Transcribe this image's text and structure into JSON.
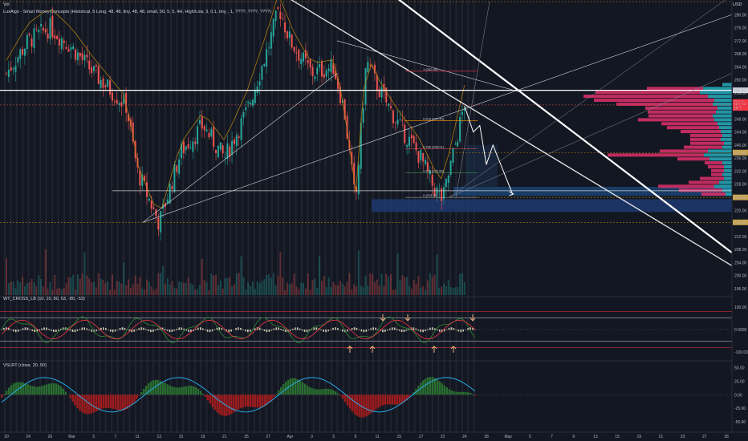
{
  "header": {
    "vol_label": "Vol",
    "smc_label": "LuxAlgo - Smart Money Concepts (Historical, 5 Long, 48, 48, tiny, 48, 48, small, 50, 5, 5, 4H, High/Low, 3, 0.1, tiny, , 1, ????, ????, ????)",
    "usd_label": "USD"
  },
  "panes": {
    "wt_label": "WT_CROSS_LB (10, 10, 80, 53, -80, -53)",
    "vslrt_label": "VSLRT (close, 20, 50)"
  },
  "price_axis": {
    "ticks": [
      "280.00",
      "276.00",
      "272.00",
      "268.00",
      "264.00",
      "260.00",
      "256.00",
      "252.00",
      "248.00",
      "244.00",
      "240.00",
      "236.00",
      "232.00",
      "228.00",
      "224.00",
      "220.00",
      "216.00",
      "212.00",
      "208.00",
      "204.00",
      "200.00",
      "196.00"
    ],
    "tick_values": [
      280,
      276,
      272,
      268,
      264,
      260,
      256,
      252,
      248,
      244,
      240,
      236,
      232,
      228,
      224,
      220,
      216,
      212,
      208,
      204,
      200,
      196
    ],
    "badges": [
      {
        "text": "256.80",
        "value": 256.8,
        "color": "#d1d4dc",
        "fg": "#131722"
      },
      {
        "text": "TSLA",
        "value": 253.2,
        "color": "#f23645",
        "fg": "#ffffff"
      },
      {
        "text": "252.75",
        "value": 252.3,
        "color": "#f23645",
        "fg": "#ffffff"
      },
      {
        "text": "1h 7",
        "value": 251.4,
        "color": "#f23645",
        "fg": "#ffffff"
      },
      {
        "text": "237.68",
        "value": 237.7,
        "color": "#c8a24a",
        "fg": "#131722"
      },
      {
        "text": "223.96",
        "value": 223.96,
        "color": "#c8a24a",
        "fg": "#131722"
      },
      {
        "text": "216.30",
        "value": 216.3,
        "color": "#c8a24a",
        "fg": "#131722"
      }
    ]
  },
  "wt_axis": {
    "ticks": [
      "100.00",
      "0.0000",
      "-100.00"
    ],
    "tick_values": [
      100,
      0,
      -100
    ]
  },
  "vslrt_axis": {
    "ticks": [
      "50.00",
      "25.00",
      "0.00",
      "-25.00",
      "-50.00"
    ],
    "tick_values": [
      50,
      25,
      0,
      -25,
      -50
    ]
  },
  "time_axis": {
    "labels": [
      "20",
      "24",
      "26",
      "Mar",
      "5",
      "7",
      "11",
      "13",
      "15",
      "19",
      "21",
      "25",
      "27",
      "Apr",
      "3",
      "5",
      "9",
      "11",
      "15",
      "17",
      "22",
      "24",
      "28",
      "May",
      "5",
      "7",
      "9",
      "13",
      "15",
      "19",
      "21",
      "23",
      "27",
      "28"
    ]
  },
  "fib_labels": [
    {
      "text": "1 (262.66)",
      "price": 262.66
    },
    {
      "text": "0.618 (247.49)",
      "price": 247.49
    },
    {
      "text": "0.786 (238.91)",
      "price": 238.91
    },
    {
      "text": "0.236 (231.56)",
      "price": 231.56
    },
    {
      "text": "0 (223.96)",
      "price": 223.96
    }
  ],
  "colors": {
    "background": "#131722",
    "bull": "#26a69a",
    "bear": "#ef5350",
    "volume_profile_up": "#26a4b4",
    "volume_profile_down": "#e0306a",
    "ma": "#b8860b",
    "trendline": "#e8e8e8",
    "ob_blue": "#1e3a6e",
    "wt_line1": "#e8e8e8",
    "wt_red": "#f23645",
    "vslrt_green": "#2e7d32",
    "vslrt_red": "#b71c1c",
    "vslrt_line": "#29b6f6",
    "annot_arrow": "#f0b27a"
  },
  "chart_data": [
    {
      "type": "candlestick",
      "title": "",
      "ylim": [
        194,
        284
      ],
      "price_path_summary": [
        {
          "x": "Feb 20",
          "price": 262
        },
        {
          "x": "Feb 24",
          "price": 272
        },
        {
          "x": "Feb 26",
          "price": 276
        },
        {
          "x": "Mar 1",
          "price": 270
        },
        {
          "x": "Mar 5",
          "price": 262
        },
        {
          "x": "Mar 8",
          "price": 252
        },
        {
          "x": "Mar 11",
          "price": 232
        },
        {
          "x": "Mar 13",
          "price": 216
        },
        {
          "x": "Mar 15",
          "price": 238
        },
        {
          "x": "Mar 19",
          "price": 246
        },
        {
          "x": "Mar 21",
          "price": 236
        },
        {
          "x": "Mar 25",
          "price": 250
        },
        {
          "x": "Mar 27",
          "price": 270
        },
        {
          "x": "Mar 29",
          "price": 282
        },
        {
          "x": "Apr 1",
          "price": 272
        },
        {
          "x": "Apr 3",
          "price": 262
        },
        {
          "x": "Apr 5",
          "price": 264
        },
        {
          "x": "Apr 7",
          "price": 250
        },
        {
          "x": "Apr 9",
          "price": 222
        },
        {
          "x": "Apr 10",
          "price": 266
        },
        {
          "x": "Apr 11",
          "price": 258
        },
        {
          "x": "Apr 15",
          "price": 246
        },
        {
          "x": "Apr 17",
          "price": 236
        },
        {
          "x": "Apr 19",
          "price": 228
        },
        {
          "x": "Apr 22",
          "price": 223
        },
        {
          "x": "Apr 24",
          "price": 252.75
        }
      ],
      "projection_path": [
        {
          "x": "Apr 24",
          "price": 252
        },
        {
          "x": "Apr 25",
          "price": 244
        },
        {
          "x": "Apr 26",
          "price": 246
        },
        {
          "x": "Apr 27",
          "price": 234
        },
        {
          "x": "Apr 28",
          "price": 240
        },
        {
          "x": "Apr 30",
          "price": 225
        }
      ],
      "horizontal_levels": [
        256.8,
        237.68,
        226.0,
        223.96,
        216.3
      ]
    },
    {
      "type": "line",
      "title": "WT_CROSS_LB (10, 10, 80, 53, -80, -53)",
      "ylim": [
        -140,
        140
      ],
      "levels": [
        80,
        53,
        -53,
        -80
      ]
    },
    {
      "type": "area",
      "title": "VSLRT (close, 20, 50)",
      "ylim": [
        -65,
        60
      ]
    }
  ]
}
